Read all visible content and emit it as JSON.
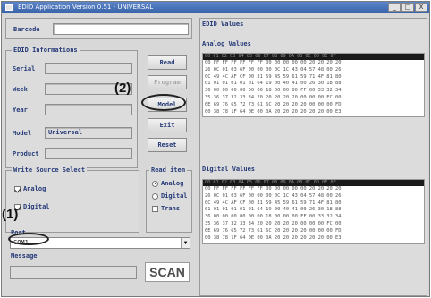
{
  "window": {
    "title": "EDID Application Version 0.51 - UNIVERSAL",
    "controls": [
      "_",
      "□",
      "X"
    ]
  },
  "barcode": {
    "label": "Barcode",
    "value": ""
  },
  "edid_info": {
    "title": "EDID Informations",
    "fields": [
      {
        "label": "Serial",
        "value": ""
      },
      {
        "label": "Week",
        "value": ""
      },
      {
        "label": "Year",
        "value": ""
      },
      {
        "label": "Model",
        "value": "Universal"
      },
      {
        "label": "Product",
        "value": ""
      }
    ]
  },
  "buttons": {
    "read": "Read",
    "program": "Program",
    "model": "Model",
    "exit": "Exit",
    "reset": "Reset"
  },
  "write_source": {
    "title": "Write Source Select",
    "analog": {
      "label": "Analog",
      "checked": true
    },
    "digital": {
      "label": "Digital",
      "checked": true
    }
  },
  "read_item": {
    "title": "Read item",
    "options": [
      {
        "label": "Analog",
        "selected": true
      },
      {
        "label": "Digital",
        "selected": false
      },
      {
        "label": "Trans",
        "selected": false
      }
    ]
  },
  "port": {
    "label": "Port",
    "value": "COM1"
  },
  "message": {
    "label": "Message",
    "value": ""
  },
  "scan_label": "SCAN",
  "edid_values": {
    "title": "EDID Values",
    "analog": {
      "title": "Analog Values",
      "header": "00 01 02 03 04 05 06 07 08 09 0A 0B 0C 0D 0E 0F",
      "rows": [
        "00 FF FF FF FF FF FF 00 00 00 00 00 20 20 20 20",
        "26 0C 01 03 6F 00 00 00 0C 1C 43 04 57 48 00 26",
        "0C 49 4C AF CF 00 31 59 45 59 61 59 71 4F 81 80",
        "01 01 01 01 01 01 64 19 00 40 41 00 26 30 18 88",
        "36 00 00 00 00 00 00 18 00 00 00 FF 00 33 32 34",
        "35 36 37 32 33 34 20 20 20 20 20 00 00 00 FC 00",
        "6E 69 76 65 72 73 61 6C 20 20 20 20 00 00 00 FD",
        "00 38 78 1F 64 0E 00 0A 20 20 20 20 20 20 00 E3"
      ]
    },
    "digital": {
      "title": "Digital Values",
      "header": "00 01 02 03 04 05 06 07 08 09 0A 0B 0C 0D 0E 0F",
      "rows": [
        "00 FF FF FF FF FF FF 00 00 00 00 00 20 20 20 20",
        "26 0C 01 03 6F 00 00 00 0C 1C 43 04 57 48 00 26",
        "0C 49 4C AF CF 00 31 59 45 59 61 59 71 4F 81 80",
        "01 01 01 01 01 01 64 19 00 40 41 00 26 30 18 88",
        "36 00 00 00 00 00 00 18 00 00 00 FF 00 33 32 34",
        "35 36 37 32 33 34 20 20 20 20 20 00 00 00 FC 00",
        "6E 69 76 65 72 73 61 6C 20 20 20 20 00 00 00 FD",
        "00 38 78 1F 64 0E 00 0A 20 20 20 20 20 20 00 E3"
      ]
    }
  },
  "annotations": {
    "first": "(1)",
    "second": "(2)"
  }
}
